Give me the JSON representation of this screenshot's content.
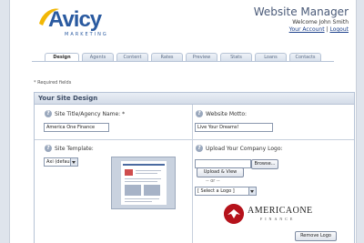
{
  "header": {
    "logo_text": "Avicy",
    "logo_sub": "MARKETING",
    "app_title": "Website Manager",
    "welcome": "Welcome John Smith",
    "account_link": "Your Account",
    "separator": "|",
    "logout_link": "Logout"
  },
  "tabs": [
    {
      "label": "Design",
      "active": true
    },
    {
      "label": "Agents",
      "active": false
    },
    {
      "label": "Content",
      "active": false
    },
    {
      "label": "Rates",
      "active": false
    },
    {
      "label": "Preview",
      "active": false
    },
    {
      "label": "Stats",
      "active": false
    },
    {
      "label": "Loans",
      "active": false
    },
    {
      "label": "Contacts",
      "active": false
    }
  ],
  "required_note": "* Required fields",
  "section": {
    "title": "Your Site Design",
    "site_title_label": "Site Title/Agency Name: *",
    "site_title_value": "America One Finance",
    "motto_label": "Website Motto:",
    "motto_value": "Live Your Dreams!",
    "template_label": "Site Template:",
    "template_value": "Axi (default)",
    "logo_label": "Upload Your Company Logo:",
    "browse_button": "Browse...",
    "upload_button": "Upload & View",
    "or_text": "-- or --",
    "select_logo": "[ Select a Logo ]",
    "remove_button": "Remove Logo",
    "help_glyph": "?"
  },
  "company_logo": {
    "name": "AMERICAONE",
    "sub": "FINANCE"
  },
  "colors": {
    "brand": "#2a5aa0",
    "seal": "#b5121b"
  }
}
